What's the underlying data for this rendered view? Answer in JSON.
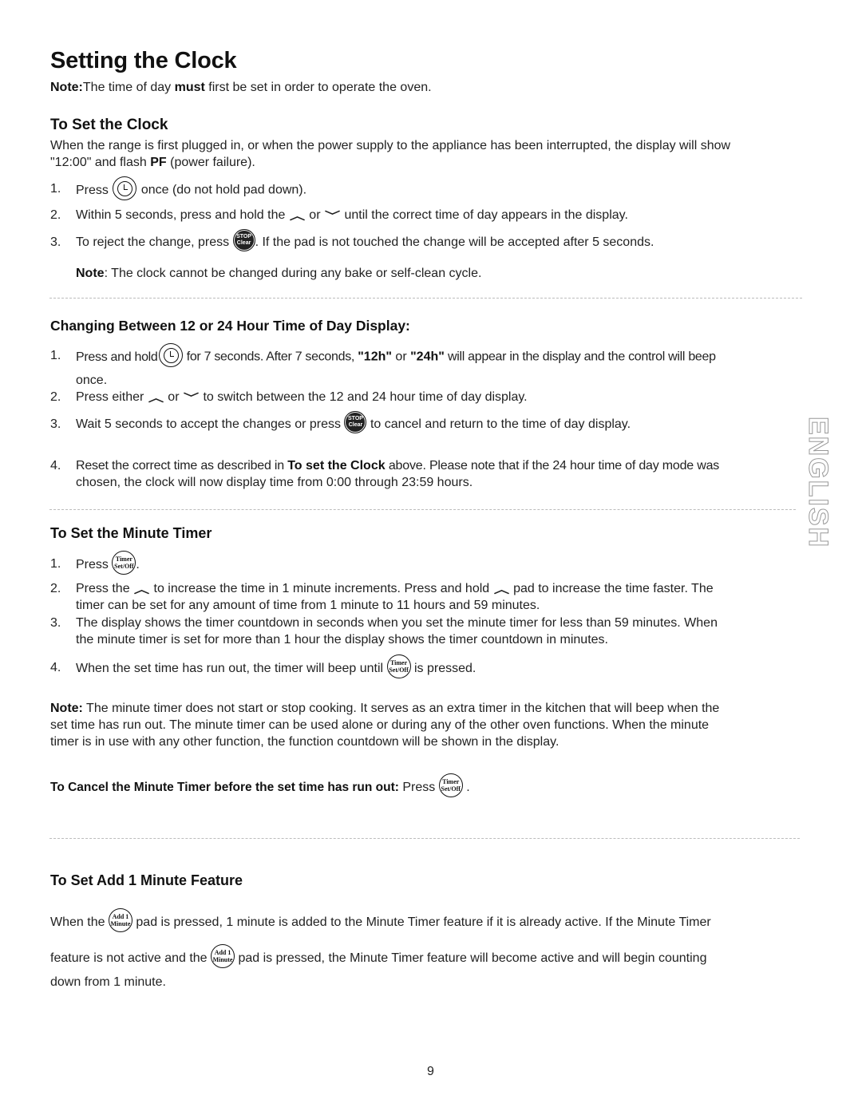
{
  "page": {
    "title": "Setting the Clock",
    "intro_note_label": "Note:",
    "intro_note_pre": "The time of day ",
    "intro_note_bold": "must",
    "intro_note_post": " first be set in order to operate the oven.",
    "side_tab": "ENGLISH",
    "page_number": "9"
  },
  "set_clock": {
    "heading": "To Set the Clock",
    "para_line1": "When the range is first plugged in, or when the power supply to the appliance has been interrupted, the display will show",
    "para_line2_pre": "\"12:00\" and flash ",
    "para_line2_bold": "PF",
    "para_line2_post": " (power failure).",
    "steps": [
      {
        "num": "1.",
        "pre": "Press",
        "post": "once (do not hold pad down)."
      },
      {
        "num": "2.",
        "pre": "Within 5 seconds, press and hold the",
        "mid": "or",
        "post": "until the correct time of day appears in the display."
      },
      {
        "num": "3.",
        "pre": "To reject the change, press",
        "post": ". If the pad is not touched the change will be accepted after 5 seconds."
      }
    ],
    "note_label": "Note",
    "note_text": ": The clock cannot be changed during any bake or self-clean cycle."
  },
  "change_display": {
    "heading": "Changing Between 12 or 24 Hour Time of Day Display:",
    "steps": [
      {
        "num": "1.",
        "pre": "Press and hold",
        "post_a": " for 7 seconds. After 7 seconds, ",
        "bold_a": "\"12h\"",
        "mid": " or ",
        "bold_b": "\"24h\"",
        "post_b": " will appear in the display and the control will beep",
        "line2": "once."
      },
      {
        "num": "2.",
        "pre": "Press either",
        "mid": "or",
        "post": "to switch between the 12 and 24 hour time of day display."
      },
      {
        "num": "3.",
        "pre": "Wait 5 seconds to accept the changes or press",
        "post": "to cancel and return to the time of day display."
      },
      {
        "num": "4.",
        "pre": "Reset the correct time as described in ",
        "bold": "To set the Clock",
        "post": " above. Please note that if the 24 hour time of day mode was",
        "line2": "chosen, the clock will now display time from 0:00 through 23:59 hours."
      }
    ]
  },
  "minute_timer": {
    "heading": "To Set the Minute Timer",
    "steps": [
      {
        "num": "1.",
        "pre": "Press",
        "post": "."
      },
      {
        "num": "2.",
        "pre": "Press the",
        "mid": "to increase the time in 1 minute increments. Press and hold",
        "post": "pad to increase the time faster. The",
        "line2": "timer can be set for any amount of time from 1 minute to 11 hours and 59 minutes."
      },
      {
        "num": "3.",
        "line1": "The display shows the timer countdown in seconds when you set the minute timer for less than 59 minutes. When",
        "line2": "the minute timer is set for more than 1 hour the display shows the timer countdown in minutes."
      },
      {
        "num": "4.",
        "pre": "When the set time has run out, the timer will beep until",
        "post": "is pressed."
      }
    ],
    "note_label": "Note:",
    "note_line1": " The minute timer does not start or stop cooking. It serves as an extra timer in the kitchen that will beep when the",
    "note_line2": "set time has run out. The minute timer can be used alone or during any of the other oven functions. When the minute",
    "note_line3": "timer is in use with any other function, the function countdown will be shown in the display.",
    "cancel_bold": "To Cancel the Minute Timer before the set time has run out:",
    "cancel_post": " Press",
    "cancel_end": "."
  },
  "add_minute": {
    "heading": "To Set Add 1 Minute Feature",
    "line1_pre": "When the",
    "line1_post": "pad is pressed, 1 minute is added to the Minute Timer feature if it is already active. If the Minute Timer",
    "line2_pre": "feature is not active and the",
    "line2_post": "pad is pressed, the Minute Timer feature will become active and will begin counting",
    "line3": "down from 1 minute."
  },
  "icons": {
    "stop_top": "STOP",
    "stop_bottom": "Clear",
    "timer_top": "Timer",
    "timer_bottom": "Set/Off",
    "add_top": "Add 1",
    "add_bottom": "Minute",
    "up_arrow": "︿",
    "down_arrow": "﹀"
  }
}
